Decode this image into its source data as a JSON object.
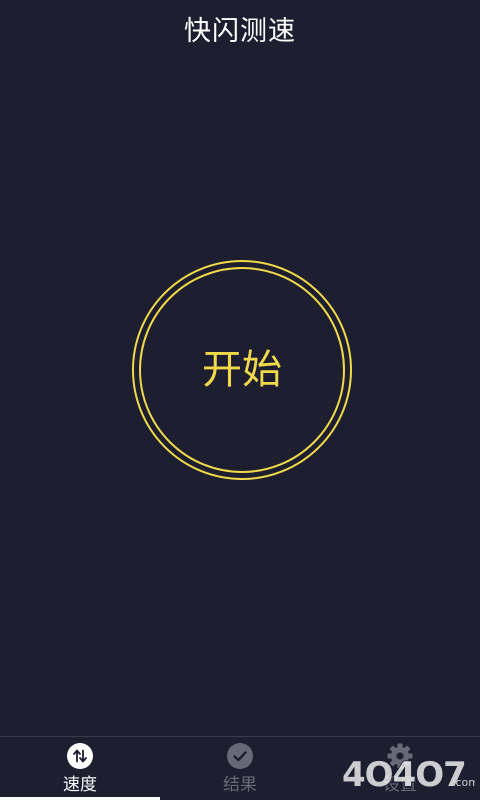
{
  "app": {
    "title": "快闪测速"
  },
  "main": {
    "start_label": "开始",
    "accent_color": "#f1d94a",
    "background_color": "#1d1e30"
  },
  "nav": {
    "tabs": [
      {
        "label": "速度",
        "icon": "up-down-arrows-icon",
        "active": true
      },
      {
        "label": "结果",
        "icon": "check-circle-icon",
        "active": false
      },
      {
        "label": "设置",
        "icon": "settings-icon",
        "active": false
      }
    ]
  },
  "watermark": {
    "text": "4O4O7",
    "suffix": ".com"
  }
}
